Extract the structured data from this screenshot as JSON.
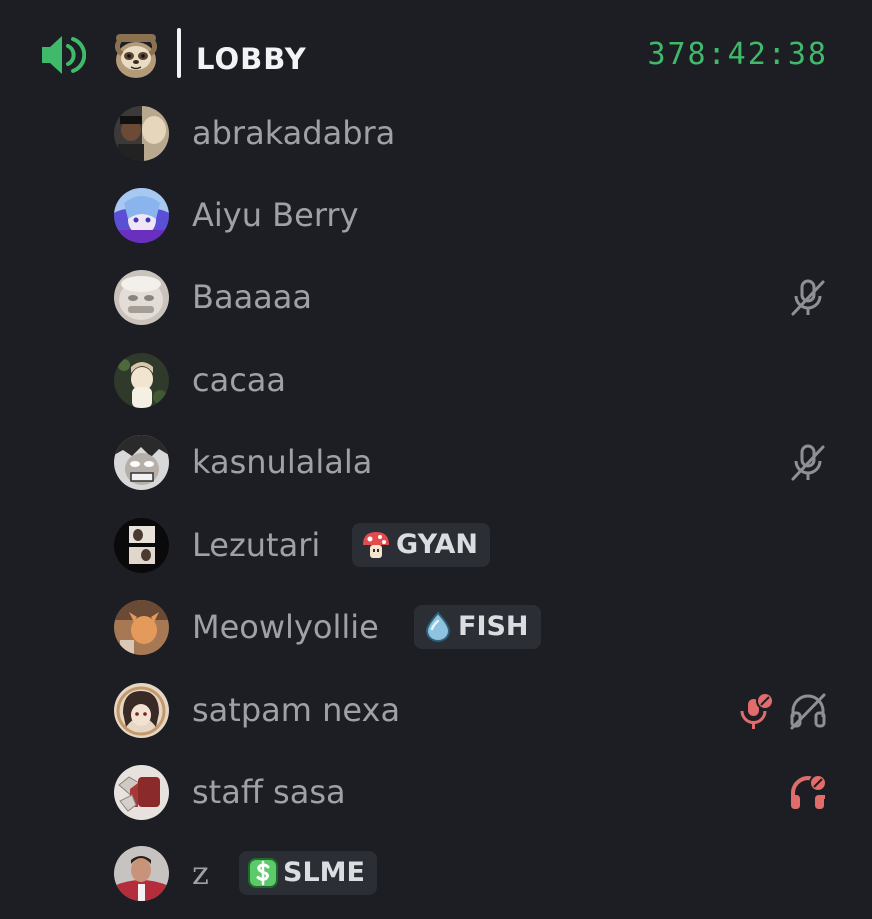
{
  "channel": {
    "name": "LOBBY",
    "timer": "378:42:38",
    "speaker_icon": "speaker-volume-icon",
    "emoji_icon": "sloth-emoji-icon"
  },
  "members": [
    {
      "name": "abrakadabra",
      "tag": null,
      "muted": false,
      "deafened": false
    },
    {
      "name": "Aiyu Berry",
      "tag": null,
      "muted": false,
      "deafened": false
    },
    {
      "name": "Baaaaa",
      "tag": null,
      "muted": true,
      "deafened": false
    },
    {
      "name": "cacaa",
      "tag": null,
      "muted": false,
      "deafened": false
    },
    {
      "name": "kasnulalala",
      "tag": null,
      "muted": true,
      "deafened": false
    },
    {
      "name": "Lezutari",
      "tag": {
        "label": "GYAN",
        "icon": "mushroom-icon"
      },
      "muted": false,
      "deafened": false
    },
    {
      "name": "Meowlyollie",
      "tag": {
        "label": "FISH",
        "icon": "water-drop-icon"
      },
      "muted": false,
      "deafened": false
    },
    {
      "name": "satpam nexa",
      "tag": null,
      "server_muted": true,
      "deafened": true
    },
    {
      "name": "staff sasa",
      "tag": null,
      "server_deafened": true
    },
    {
      "name": "z",
      "tag": {
        "label": "SLME",
        "icon": "dollar-icon"
      },
      "muted": false,
      "deafened": false
    }
  ],
  "colors": {
    "background": "#1d1e23",
    "timer_green": "#3fb96a",
    "speaker_green": "#3fb96a",
    "username_gray": "#9fa1a8",
    "muted_gray": "#8e9097",
    "server_red": "#e06c6c",
    "tag_bg": "#2c2e35"
  }
}
